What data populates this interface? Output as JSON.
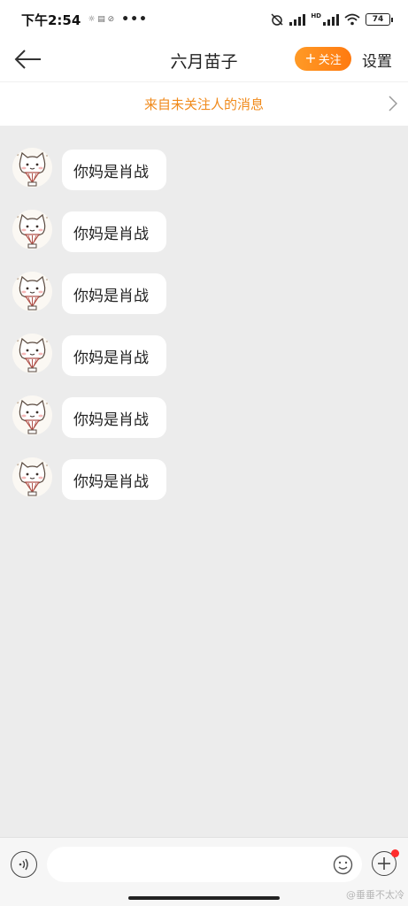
{
  "status_bar": {
    "time": "下午2:54",
    "mini_icons": "☼ ▤ ⊘",
    "dots": "•••",
    "battery": "74",
    "network": "HD"
  },
  "header": {
    "title": "六月苗子",
    "follow_plus": "+",
    "follow_label": "关注",
    "settings_label": "设置"
  },
  "notice": {
    "text": "来自未关注人的消息"
  },
  "messages": [
    {
      "text": "你妈是肖战"
    },
    {
      "text": "你妈是肖战"
    },
    {
      "text": "你妈是肖战"
    },
    {
      "text": "你妈是肖战"
    },
    {
      "text": "你妈是肖战"
    },
    {
      "text": "你妈是肖战"
    }
  ],
  "input": {
    "value": "",
    "placeholder": ""
  },
  "watermark": "@垂垂不太冷",
  "colors": {
    "accent": "#ff8a1f",
    "notice_text": "#f08a1b",
    "chat_background": "#ececec",
    "badge": "#ff2d2d"
  },
  "icons": [
    "back-arrow-icon",
    "chevron-right-icon",
    "cat-avatar-icon",
    "voice-icon",
    "emoji-icon",
    "plus-icon"
  ]
}
